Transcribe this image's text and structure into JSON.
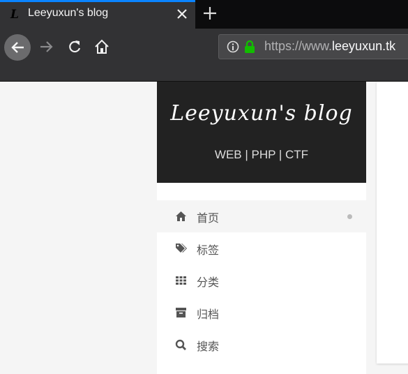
{
  "browser": {
    "tab": {
      "favicon_letter": "L",
      "title": "Leeyuxun's blog"
    },
    "address_bar": {
      "scheme": "https://www.",
      "host": "leeyuxun.tk"
    },
    "icons": [
      "back-icon",
      "forward-icon",
      "reload-icon",
      "home-icon",
      "info-icon",
      "lock-icon",
      "close-icon",
      "plus-icon"
    ]
  },
  "site": {
    "title": "Leeyuxun's blog",
    "subtitle": "WEB | PHP | CTF"
  },
  "menu": {
    "items": [
      {
        "label": "首页",
        "icon": "home-icon",
        "active": true
      },
      {
        "label": "标签",
        "icon": "tags-icon",
        "active": false
      },
      {
        "label": "分类",
        "icon": "grid-icon",
        "active": false
      },
      {
        "label": "归档",
        "icon": "archive-icon",
        "active": false
      },
      {
        "label": "搜索",
        "icon": "search-icon",
        "active": false
      }
    ]
  },
  "colors": {
    "accent": "#0a84ff",
    "secure": "#12bc00",
    "header_bg": "#222222"
  }
}
